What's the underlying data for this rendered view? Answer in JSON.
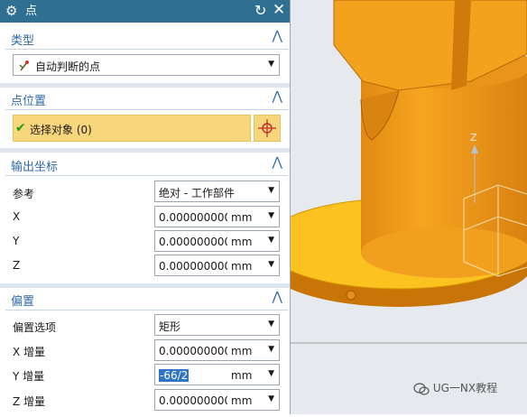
{
  "dialog": {
    "title": "点",
    "icon": "gear-icon",
    "reset_icon": "reset-icon",
    "close_icon": "close-icon",
    "title_bg": "#2f6f92"
  },
  "type_section": {
    "label": "类型",
    "selected": "自动判断的点"
  },
  "point_location": {
    "label": "点位置",
    "select_object": "选择对象 (0)",
    "highlight_color": "#f8d67b"
  },
  "output_coords": {
    "label": "输出坐标",
    "reference_label": "参考",
    "reference_value": "绝对 - 工作部件",
    "x_label": "X",
    "y_label": "Y",
    "z_label": "Z",
    "x_value": "0.0000000000",
    "y_value": "0.0000000000",
    "z_value": "0.0000000000",
    "unit": "mm"
  },
  "offset": {
    "label": "偏置",
    "option_label": "偏置选项",
    "option_value": "矩形",
    "x_inc_label": "X 增量",
    "y_inc_label": "Y 增量",
    "z_inc_label": "Z 增量",
    "x_inc_value": "0.0000000000",
    "y_inc_value": "-66/2",
    "z_inc_value": "0.0000000000",
    "unit": "mm"
  },
  "viewport": {
    "axis_label": "Z",
    "model_color": "#f5a623",
    "background": "#e6e9ee"
  },
  "watermark": "UG一NX教程"
}
